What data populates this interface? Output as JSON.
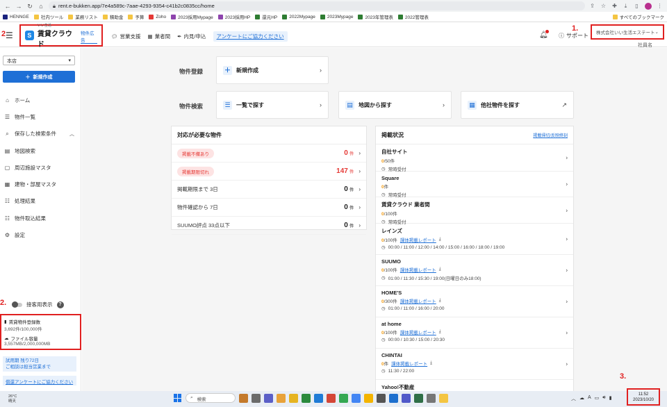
{
  "browser": {
    "url": "rent.e-bukken.app/7e4a589c-7aae-4293-9354-c41b2c0835cc/home",
    "bookmarks": [
      "HENNGE",
      "社内ツール",
      "業務リスト",
      "積助金",
      "予算",
      "Zoho",
      "2023採用Mypage",
      "2023採用HP",
      "還元HP",
      "2022Mypage",
      "2023Mypage",
      "2023年管理表",
      "2022管理表"
    ],
    "bookmarks_right": "すべてのブックマーク"
  },
  "annotations": {
    "n1": "1.",
    "n2": "2",
    "n2b": "2.",
    "n3": "3."
  },
  "header": {
    "logo_small": "いい生活",
    "logo_main": "賃貸クラウド",
    "logo_sub": "物件広告",
    "nav": [
      "営業支援",
      "業者間",
      "内見/申込"
    ],
    "survey": "アンケートにご協力ください",
    "support": "サポート",
    "company": "株式会社いい生活エステート",
    "company_sub": "社員名"
  },
  "sidebar": {
    "store": "本店",
    "new_button": "新規作成",
    "items": [
      {
        "label": "ホーム",
        "icon": "home-icon"
      },
      {
        "label": "物件一覧",
        "icon": "list-icon"
      },
      {
        "label": "保存した検索条件",
        "icon": "search-save-icon"
      },
      {
        "label": "地図検索",
        "icon": "map-icon"
      },
      {
        "label": "周辺施設マスタ",
        "icon": "facility-icon"
      },
      {
        "label": "建物・部屋マスタ",
        "icon": "building-icon"
      },
      {
        "label": "処理結果",
        "icon": "result-icon"
      },
      {
        "label": "物件取込結果",
        "icon": "import-icon"
      },
      {
        "label": "設定",
        "icon": "gear-icon"
      }
    ],
    "toggle_label": "接客用表示",
    "usage": {
      "label1": "賃貸物件登録数",
      "value1": "3,692件/100,000件",
      "label2": "ファイル容量",
      "value2": "3,557MB/2,000,000MB"
    },
    "trial_line1": "試用期 残り72日",
    "trial_line2": "ご相談は担当営業まで",
    "survey": "償還アンケートにご協力ください"
  },
  "main": {
    "register_label": "物件登録",
    "search_label": "物件検索",
    "new_card": "新規作成",
    "search_cards": [
      "一覧で探す",
      "地図から探す",
      "他社物件を探す"
    ],
    "required": {
      "title": "対応が必要な物件",
      "rows": [
        {
          "label": "掲載不備あり",
          "value": "0",
          "unit": "件",
          "badge": true,
          "red": true
        },
        {
          "label": "掲載期限切れ",
          "value": "147",
          "unit": "件",
          "badge": true,
          "red": true
        },
        {
          "label": "掲載期限まで 3日",
          "value": "0",
          "unit": "件",
          "badge": false,
          "red": false
        },
        {
          "label": "物件確認から 7日",
          "value": "0",
          "unit": "件",
          "badge": false,
          "red": false
        },
        {
          "label": "SUUMO評点 33点以下",
          "value": "0",
          "unit": "件",
          "badge": false,
          "red": false
        }
      ]
    },
    "listing": {
      "title": "掲載状況",
      "link": "掲載帰切/反映終刻",
      "rows": [
        {
          "name": "自社サイト",
          "count": "0",
          "total": "/50件",
          "status": "常時受付",
          "report": "",
          "times": ""
        },
        {
          "name": "Square",
          "count": "0",
          "total": "件",
          "status": "常時受付",
          "report": "",
          "times": ""
        },
        {
          "name": "賃貸クラウド 業者間",
          "count": "0",
          "total": "/100件",
          "status": "常時受付",
          "report": "",
          "times": ""
        },
        {
          "name": "レインズ",
          "count": "0",
          "total": "/100件",
          "status": "",
          "report": "課体掲載レポート",
          "times": "00:00 / 11:00 / 12:00 / 14:00 / 15:00 / 16:00 / 18:00 / 19:00"
        },
        {
          "name": "SUUMO",
          "count": "0",
          "total": "/100件",
          "status": "",
          "report": "課体掲載レポート",
          "times": "01:00 / 11:30 / 15:30 / 19:00(日曜日のみ18:00)"
        },
        {
          "name": "HOME'S",
          "count": "0",
          "total": "/300件",
          "status": "",
          "report": "課体掲載レポート",
          "times": "01:00 / 11:00 / 16:00 / 20:00"
        },
        {
          "name": "at home",
          "count": "0",
          "total": "/100件",
          "status": "",
          "report": "課体掲載レポート",
          "times": "00:00 / 10:30 / 15:00 / 20:30"
        },
        {
          "name": "CHINTAI",
          "count": "0",
          "total": "件",
          "status": "",
          "report": "課体掲載レポート",
          "times": "11:30 / 22:00"
        },
        {
          "name": "Yahoo!不動産",
          "count": "",
          "total": "",
          "status": "",
          "report": "",
          "times": ""
        }
      ]
    }
  },
  "taskbar": {
    "temp": "26°C",
    "weather": "晴天",
    "search": "検索",
    "time": "11:52",
    "date": "2023/10/20"
  }
}
